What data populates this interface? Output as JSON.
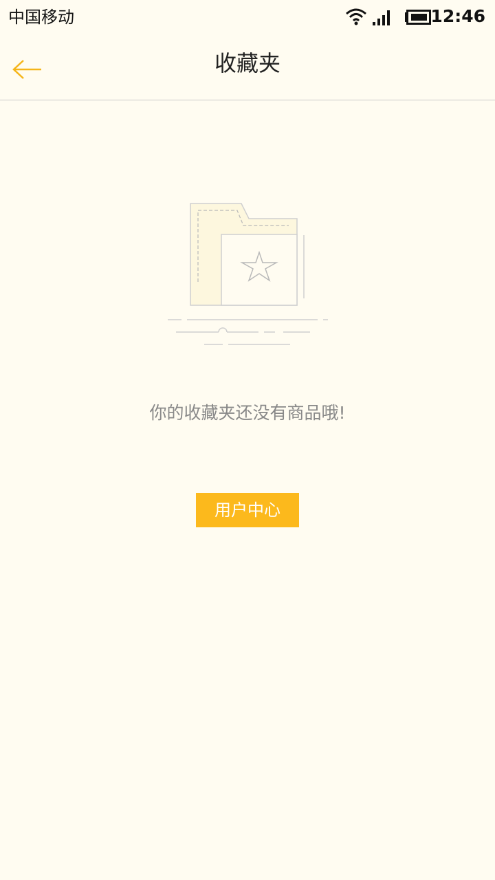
{
  "status_bar": {
    "carrier": "中国移动",
    "time": "12:46",
    "icons": [
      "wifi-icon",
      "signal-icon",
      "battery-icon"
    ]
  },
  "nav_bar": {
    "title": "收藏夹",
    "back_icon": "arrow-left-icon"
  },
  "empty_state": {
    "illustration_icon": "folder-star-icon",
    "message": "你的收藏夹还没有商品哦!"
  },
  "actions": {
    "user_center_label": "用户中心"
  },
  "colors": {
    "background": "#fffcf1",
    "accent": "#fcb91c",
    "divider": "#c9c9c9",
    "message_text": "#888888",
    "title_text": "#222222"
  }
}
